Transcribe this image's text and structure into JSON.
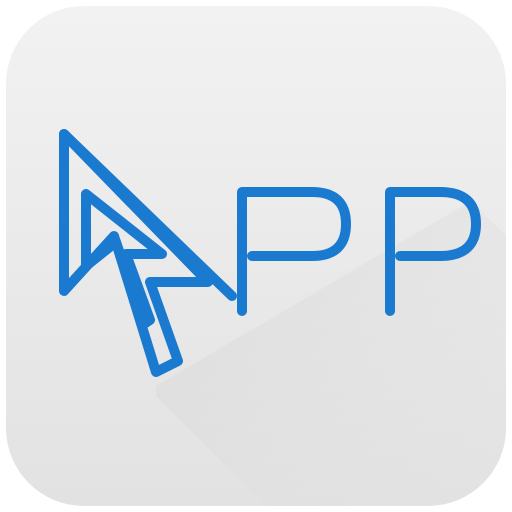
{
  "logo": {
    "text": "APP",
    "icon": "cursor-arrow-icon",
    "colors": {
      "stroke": "#1a7ad0",
      "background": "#ececec",
      "shadow": "#d4d4d4"
    }
  }
}
